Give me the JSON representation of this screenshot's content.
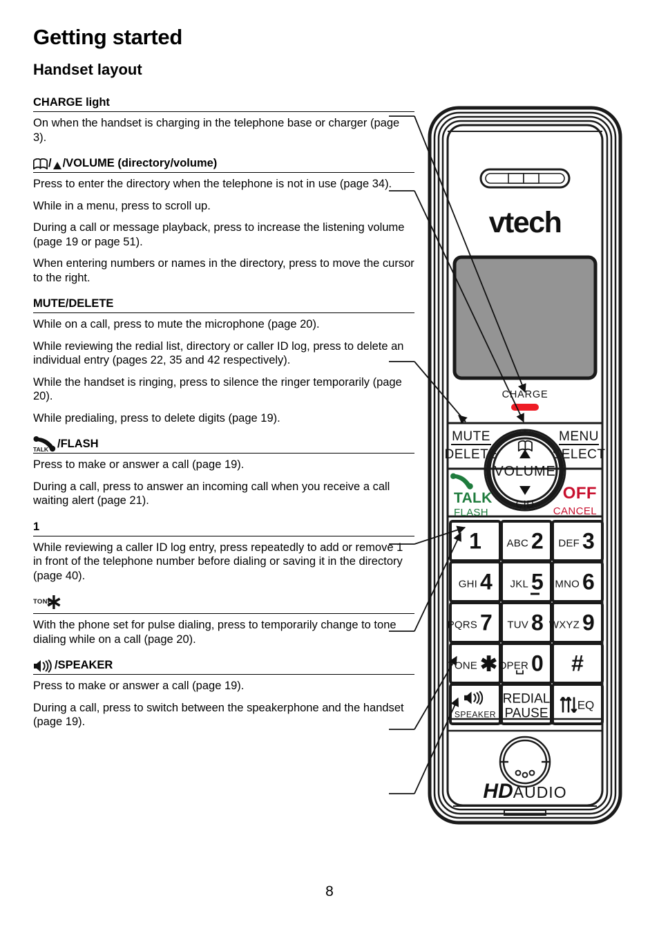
{
  "document": {
    "chapter_title": "Getting started",
    "section_title": "Handset layout",
    "page_number": "8"
  },
  "entries": [
    {
      "id": "charge-light",
      "heading_text": "CHARGE light",
      "icons": [],
      "paragraphs": [
        "On when the handset is charging in the telephone base or charger (page 3)."
      ]
    },
    {
      "id": "directory-volume",
      "heading_text": "/VOLUME (directory/volume)",
      "icons": [
        "book-icon",
        "up-triangle-icon"
      ],
      "paragraphs": [
        "Press to enter the directory when the telephone is not in use (page 34).",
        "While in a menu, press to scroll up.",
        "During a call or message playback, press to increase the listening volume (page 19 or page 51).",
        "When entering numbers or names in the directory, press to move the cursor to the right."
      ]
    },
    {
      "id": "mute-delete",
      "heading_text": "MUTE/DELETE",
      "icons": [],
      "paragraphs": [
        "While on a call, press to mute the microphone (page 20).",
        "While reviewing the redial list, directory or caller ID log, press to delete an individual entry (pages 22, 35 and 42 respectively).",
        "While the handset is ringing, press to silence the ringer temporarily (page 20).",
        "While predialing, press to delete digits (page 19)."
      ]
    },
    {
      "id": "talk-flash",
      "heading_text": "/FLASH",
      "icons": [
        "talk-handset-icon"
      ],
      "paragraphs": [
        "Press to make or answer a call (page 19).",
        "During a call, press to answer an incoming call when you receive a call waiting alert (page 21)."
      ]
    },
    {
      "id": "key-one",
      "heading_text": "1",
      "icons": [],
      "paragraphs": [
        "While reviewing a caller ID log entry, press repeatedly to add or remove 1 in front of the telephone number before dialing or saving it in the directory (page 40)."
      ]
    },
    {
      "id": "tone-star",
      "heading_text": "",
      "icons": [
        "tone-star-icon"
      ],
      "paragraphs": [
        "With the phone set for pulse dialing, press to temporarily change to tone dialing while on a call (page 20)."
      ]
    },
    {
      "id": "speaker",
      "heading_text": "/SPEAKER",
      "icons": [
        "speaker-icon"
      ],
      "paragraphs": [
        "Press to make or answer a call (page 19).",
        "During a call, press to switch between the speakerphone and the handset (page 19)."
      ]
    }
  ],
  "handset": {
    "brand_logo": "vtech",
    "charge_label": "CHARGE",
    "hd_audio_logo_bold": "HD",
    "hd_audio_logo_light": "AUDIO",
    "soft_keys": {
      "left_top": "MUTE",
      "left_bottom": "DELETE",
      "right_top": "MENU",
      "right_bottom": "SELECT"
    },
    "nav_ring": {
      "up_icon": "book-icon",
      "center_label": "VOLUME",
      "down_label": "CID"
    },
    "talk_key": {
      "icon": "talk-handset-icon",
      "label": "TALK",
      "sublabel": "FLASH"
    },
    "off_key": {
      "label": "OFF",
      "sublabel": "CANCEL"
    },
    "keypad": [
      {
        "letters": "",
        "digit": "1",
        "sub": ""
      },
      {
        "letters": "ABC",
        "digit": "2",
        "sub": ""
      },
      {
        "letters": "DEF",
        "digit": "3",
        "sub": ""
      },
      {
        "letters": "GHI",
        "digit": "4",
        "sub": ""
      },
      {
        "letters": "JKL",
        "digit": "5",
        "sub": ""
      },
      {
        "letters": "MNO",
        "digit": "6",
        "sub": ""
      },
      {
        "letters": "PQRS",
        "digit": "7",
        "sub": ""
      },
      {
        "letters": "TUV",
        "digit": "8",
        "sub": ""
      },
      {
        "letters": "WXYZ",
        "digit": "9",
        "sub": ""
      },
      {
        "letters": "TONE",
        "digit": "✱",
        "sub": ""
      },
      {
        "letters": "OPER",
        "digit": "0",
        "sub": ""
      },
      {
        "letters": "",
        "digit": "#",
        "sub": ""
      },
      {
        "letters": "",
        "digit": "",
        "sub": "SPEAKER"
      },
      {
        "letters": "",
        "digit": "REDIAL",
        "sub": "PAUSE"
      },
      {
        "letters": "",
        "digit": "EQ",
        "sub": ""
      }
    ]
  },
  "colors": {
    "talk_green": "#1e7b3c",
    "off_red": "#c8102e",
    "charge_led_red": "#ee1c25",
    "lcd_gray": "#949494",
    "outline_black": "#1a1a1a"
  }
}
